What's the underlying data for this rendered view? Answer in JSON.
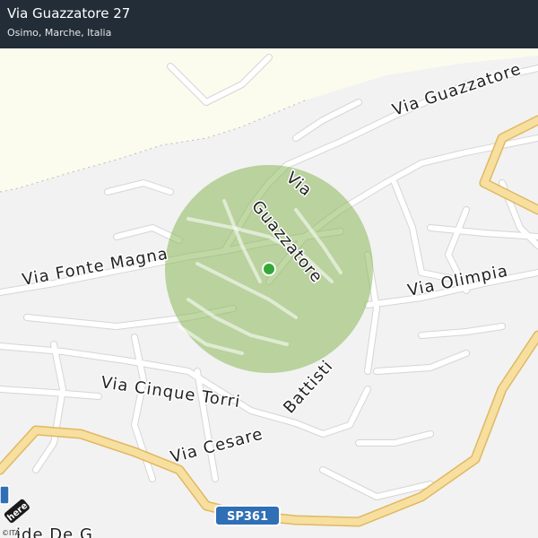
{
  "header": {
    "title": "Via Guazzatore 27",
    "subtitle": "Osimo, Marche, Italia"
  },
  "map": {
    "colors": {
      "background": "#f2f2f2",
      "park": "#fbfcee",
      "road": "#ffffff",
      "road_outline": "#d5d5d5",
      "major_road": "#f7dfa0",
      "major_road_outline": "#e0b860",
      "accuracy_circle": "#8bb85a",
      "marker": "#33a935",
      "highway_shield": "#2f6fb5"
    },
    "street_labels": [
      "Via Guazzatore",
      "Via",
      "Guazzatore",
      "Via Olimpia",
      "Via Fonte Magna",
      "Via Cinque Torri",
      "Battisti",
      "Via Cesare",
      "ide De G"
    ],
    "route_shield": "SP361",
    "brand_logo": "here",
    "copyright": "©ITA"
  }
}
